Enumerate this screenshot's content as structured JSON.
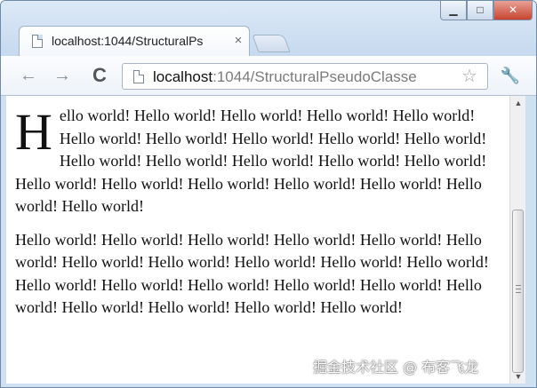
{
  "window": {
    "controls": {
      "minimize": "▁",
      "maximize": "□",
      "close": "✕"
    }
  },
  "tab": {
    "title": "localhost:1044/StructuralPs",
    "close": "×",
    "icon": "page-icon"
  },
  "toolbar": {
    "back": "←",
    "forward": "→",
    "reload": "C",
    "url_host": "localhost",
    "url_rest": ":1044/StructuralPseudoClasse",
    "bookmark": "☆",
    "menu": "🔧"
  },
  "content": {
    "paragraph1": {
      "dropcap": "H",
      "text": "ello world! Hello world! Hello world! Hello world! Hello world! Hello world! Hello world! Hello world! Hello world! Hello world! Hello world! Hello world! Hello world! Hello world! Hello world! Hello world! Hello world! Hello world! Hello world! Hello world! Hello world! Hello world!"
    },
    "paragraph2": {
      "text": "Hello world! Hello world! Hello world! Hello world! Hello world! Hello world! Hello world! Hello world! Hello world! Hello world! Hello world! Hello world! Hello world! Hello world! Hello world! Hello world! Hello world! Hello world! Hello world! Hello world! Hello world!"
    }
  },
  "scrollbar": {
    "up": "▲",
    "down": "▼"
  },
  "watermark": "掘金技术社区 @ 布客飞龙"
}
